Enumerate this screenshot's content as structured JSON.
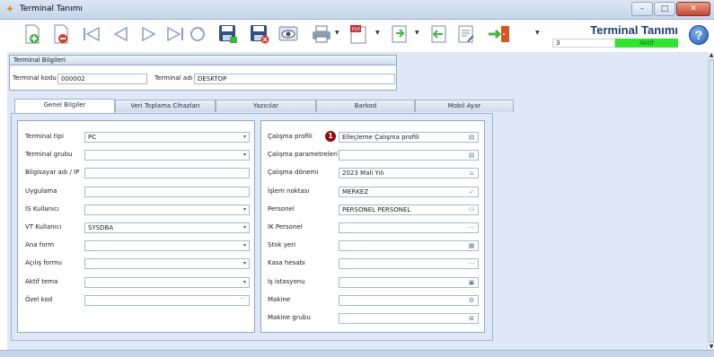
{
  "window": {
    "title": "Terminal Tanımı"
  },
  "header": {
    "title": "Terminal Tanımı",
    "code": "3",
    "status": "Aktif",
    "status_color": "#2ee62e"
  },
  "toolbar": {
    "buttons": [
      "new-icon",
      "delete-icon",
      "first-record-icon",
      "previous-record-icon",
      "next-record-icon",
      "last-record-icon",
      "refresh-icon",
      "save-icon",
      "save-close-icon",
      "preview-icon",
      "print-icon",
      "pdf-export-icon",
      "export-icon",
      "back-icon",
      "document-icon",
      "exit-icon"
    ]
  },
  "terminal_info": {
    "group_title": "Terminal Bilgileri",
    "kod_label": "Terminal kodu",
    "kod_value": "000002",
    "adi_label": "Terminal adı",
    "adi_value": "DESKTOP"
  },
  "tabs": [
    "Genel Bilgiler",
    "Veri Toplama Cihazları",
    "Yazıcılar",
    "Barkod",
    "Mobil Ayar"
  ],
  "left_fields": [
    {
      "label": "Terminal tipi",
      "value": "PC",
      "kind": "dropdown"
    },
    {
      "label": "Terminal grubu",
      "value": "",
      "kind": "dropdown"
    },
    {
      "label": "Bilgisayar adı / IP",
      "value": "",
      "kind": "text"
    },
    {
      "label": "Uygulama",
      "value": "",
      "kind": "text"
    },
    {
      "label": "İS Kullanıcı",
      "value": "",
      "kind": "dropdown"
    },
    {
      "label": "VT Kullanıcı",
      "value": "SYSDBA",
      "kind": "dropdown"
    },
    {
      "label": "Ana form",
      "value": "",
      "kind": "dropdown"
    },
    {
      "label": "Açılış formu",
      "value": "",
      "kind": "dropdown"
    },
    {
      "label": "Aktif tema",
      "value": "",
      "kind": "dropdown"
    },
    {
      "label": "Özel kod",
      "value": "",
      "kind": "lookup"
    }
  ],
  "right_fields": [
    {
      "label": "Çalışma profili",
      "value": "Elleçleme Çalışma profili",
      "icon": "list-icon"
    },
    {
      "label": "Çalışma parametreleri",
      "value": "",
      "icon": "list-icon"
    },
    {
      "label": "Çalışma dönemi",
      "value": "2023 Mali Yılı",
      "icon": "bank-icon"
    },
    {
      "label": "İşlem noktası",
      "value": "MERKEZ",
      "icon": "check-icon"
    },
    {
      "label": "Personel",
      "value": "PERSONEL PERSONEL",
      "icon": "person-icon"
    },
    {
      "label": "IK Personel",
      "value": "",
      "icon": "dots-icon"
    },
    {
      "label": "Stok yeri",
      "value": "",
      "icon": "warehouse-icon"
    },
    {
      "label": "Kasa hesabı",
      "value": "",
      "icon": "dots-icon"
    },
    {
      "label": "İş istasyonu",
      "value": "",
      "icon": "workstation-icon"
    },
    {
      "label": "Makine",
      "value": "",
      "icon": "machine-icon"
    },
    {
      "label": "Makine grubu",
      "value": "",
      "icon": "machine-group-icon"
    }
  ],
  "badge": "1"
}
